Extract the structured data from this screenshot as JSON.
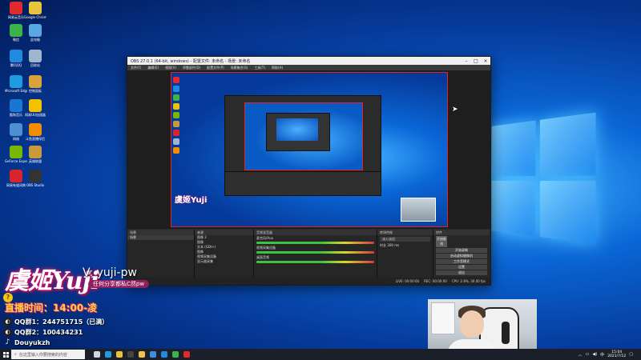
{
  "desktop": {
    "icons": [
      {
        "label": "网易云音乐",
        "color": "#e1292e"
      },
      {
        "label": "Google Chrome",
        "color": "#e9c33a"
      },
      {
        "label": "微信",
        "color": "#3bb34a"
      },
      {
        "label": "此电脑",
        "color": "#5aa7e6"
      },
      {
        "label": "腾讯QQ",
        "color": "#1f8ae0"
      },
      {
        "label": "回收站",
        "color": "#9fb7cc"
      },
      {
        "label": "Microsoft Edge",
        "color": "#1f9be0"
      },
      {
        "label": "控制面板",
        "color": "#d8a33a"
      },
      {
        "label": "酷狗音乐",
        "color": "#1976d2"
      },
      {
        "label": "网易UU加速器",
        "color": "#f2c200"
      },
      {
        "label": "网络",
        "color": "#4c8fd3"
      },
      {
        "label": "斗鱼直播伴侣",
        "color": "#f28c00"
      },
      {
        "label": "GeForce Experience",
        "color": "#76b900"
      },
      {
        "label": "英雄联盟",
        "color": "#c99a3b"
      },
      {
        "label": "网易有道词典",
        "color": "#d7252b"
      },
      {
        "label": "OBS Studio",
        "color": "#333333"
      }
    ]
  },
  "obs": {
    "title": "OBS 27.0.1 (64-bit, windows) - 配置文件: 未命名 - 场景: 未命名",
    "menu": [
      "文件(F)",
      "编辑(E)",
      "视图(V)",
      "停靠部件(D)",
      "配置文件(P)",
      "场景集合(S)",
      "工具(T)",
      "帮助(H)"
    ],
    "docks": {
      "scenes": {
        "title": "场景",
        "item": "场景"
      },
      "sources": {
        "title": "来源",
        "items": [
          "图像 2",
          "图像",
          "文本 (GDI+)",
          "图像",
          "视频采集设备",
          "显示器采集"
        ]
      },
      "mixer": {
        "title": "音频混音器",
        "items": [
          "麦克风/Aux",
          "视频采集设备",
          "桌面音频"
        ]
      },
      "transitions": {
        "title": "转场特效",
        "type": "淡入淡出",
        "duration_label": "时长",
        "duration": "300 ms"
      },
      "controls": {
        "title": "控件",
        "buttons": [
          "开始推流",
          "开始录制",
          "启动虚拟摄像机",
          "工作室模式",
          "设置",
          "退出"
        ]
      }
    },
    "status": {
      "live": "LIVE: 00:00:00",
      "rec": "REC: 00:00:00",
      "cpu": "CPU: 2.8%, 30.00 fps"
    }
  },
  "overlay": {
    "brand": "虞姬Yuji",
    "vx": "V: yuji-pw",
    "pill": "任何分享都私C然pw",
    "live_time": "直播时间：14:00-凌",
    "qq1": "QQ群1：244751715（已满）",
    "qq2": "QQ群2：100434231",
    "douyin": "Douyukzh"
  },
  "taskbar": {
    "search_placeholder": "在这里输入你要搜索的内容",
    "apps": [
      {
        "name": "task-view-icon",
        "color": "#cfd6e0"
      },
      {
        "name": "edge-icon",
        "color": "#1f9be0"
      },
      {
        "name": "chrome-icon",
        "color": "#e9c33a"
      },
      {
        "name": "obs-icon",
        "color": "#444444"
      },
      {
        "name": "explorer-icon",
        "color": "#f0c24a"
      },
      {
        "name": "store-icon",
        "color": "#3a8ee6"
      },
      {
        "name": "qq-icon",
        "color": "#1f8ae0"
      },
      {
        "name": "wechat-icon",
        "color": "#3bb34a"
      },
      {
        "name": "cloudmusic-icon",
        "color": "#e1292e"
      }
    ],
    "time": "15:04",
    "date": "2021/7/12"
  }
}
